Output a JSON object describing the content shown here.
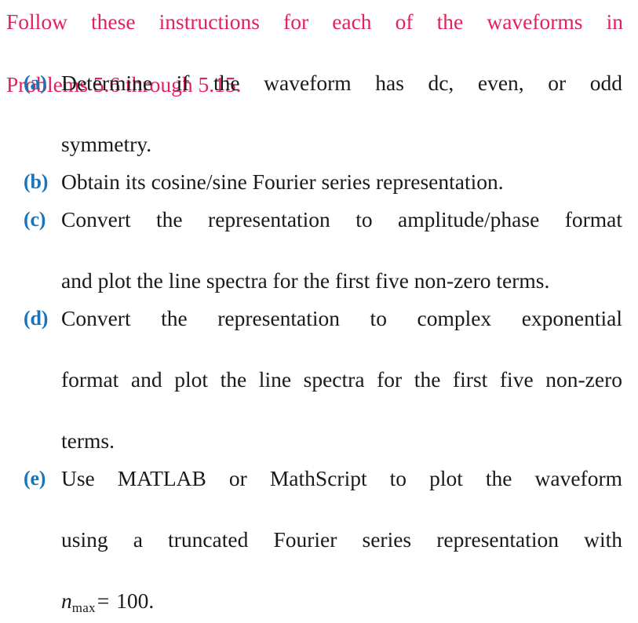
{
  "colors": {
    "intro_text": "#e4215c",
    "label": "#1b74b8",
    "body_text": "#1a1a1a",
    "background": "#ffffff"
  },
  "intro": {
    "line1": "Follow these instructions for each of the waveforms in",
    "line2": "Problems 5.6 through 5.15.",
    "full": "Follow these instructions for each of the waveforms in Problems 5.6 through 5.15."
  },
  "items": [
    {
      "label": "(a)",
      "line1": "Determine if the waveform has dc, even, or odd",
      "line2": "symmetry.",
      "line3": "",
      "full": "Determine if the waveform has dc, even, or odd symmetry."
    },
    {
      "label": "(b)",
      "line1": "Obtain its cosine/sine Fourier series representation.",
      "line2": "",
      "line3": "",
      "full": "Obtain its cosine/sine Fourier series representation."
    },
    {
      "label": "(c)",
      "line1": "Convert the representation to amplitude/phase format",
      "line2": "and plot the line spectra for the first five non-zero terms.",
      "line3": "",
      "full": "Convert the representation to amplitude/phase format and plot the line spectra for the first five non-zero terms."
    },
    {
      "label": "(d)",
      "line1": "Convert the representation to complex exponential",
      "line2": "format and plot the line spectra for the first five non-zero",
      "line3": "terms.",
      "full": "Convert the representation to complex exponential format and plot the line spectra for the first five non-zero terms."
    },
    {
      "label": "(e)",
      "line1": "Use MATLAB or MathScript to plot the waveform",
      "line2": "using a truncated Fourier series representation with",
      "line3": "",
      "math": {
        "variable": "n",
        "subscript": "max",
        "operator": "=",
        "value": "100."
      },
      "full": "Use MATLAB or MathScript to plot the waveform using a truncated Fourier series representation with n_max = 100."
    }
  ]
}
